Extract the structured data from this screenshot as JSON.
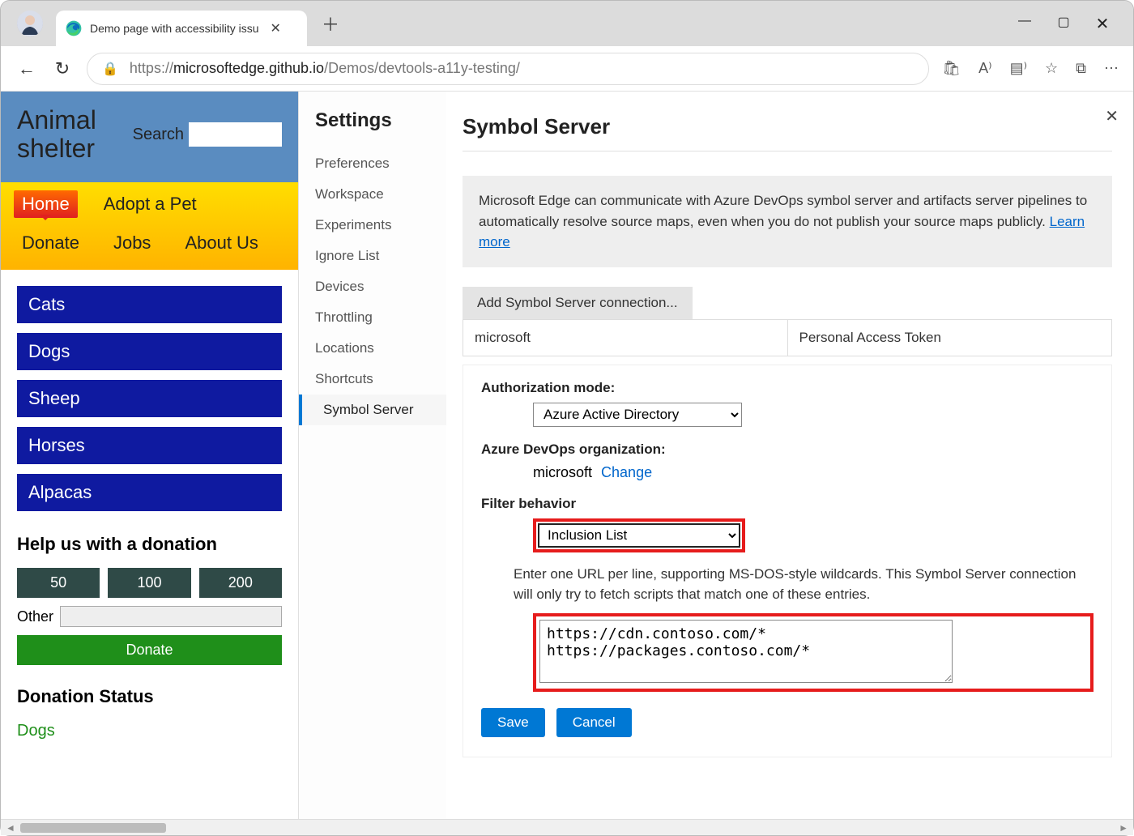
{
  "window": {
    "tab_title": "Demo page with accessibility issu",
    "url_proto": "https://",
    "url_host": "microsoftedge.github.io",
    "url_path": "/Demos/devtools-a11y-testing/"
  },
  "page": {
    "site_title": "Animal shelter",
    "search_label": "Search",
    "nav": {
      "home": "Home",
      "adopt": "Adopt a Pet",
      "donate": "Donate",
      "jobs": "Jobs",
      "about": "About Us"
    },
    "sidenav": [
      "Cats",
      "Dogs",
      "Sheep",
      "Horses",
      "Alpacas"
    ],
    "donation": {
      "heading": "Help us with a donation",
      "presets": [
        "50",
        "100",
        "200"
      ],
      "other_label": "Other",
      "button": "Donate"
    },
    "status": {
      "heading": "Donation Status",
      "rows": [
        "Dogs"
      ]
    }
  },
  "settings": {
    "title": "Settings",
    "items": [
      "Preferences",
      "Workspace",
      "Experiments",
      "Ignore List",
      "Devices",
      "Throttling",
      "Locations",
      "Shortcuts",
      "Symbol Server"
    ],
    "active": "Symbol Server"
  },
  "panel": {
    "title": "Symbol Server",
    "info": "Microsoft Edge can communicate with Azure DevOps symbol server and artifacts server pipelines to automatically resolve source maps, even when you do not publish your source maps publicly. ",
    "learn_more": "Learn more",
    "add_button": "Add Symbol Server connection...",
    "col_org": "microsoft",
    "col_auth": "Personal Access Token",
    "auth_label": "Authorization mode:",
    "auth_value": "Azure Active Directory",
    "org_label": "Azure DevOps organization:",
    "org_value": "microsoft",
    "org_change": "Change",
    "filter_label": "Filter behavior",
    "filter_value": "Inclusion List",
    "hint": "Enter one URL per line, supporting MS-DOS-style wildcards. This Symbol Server connection will only try to fetch scripts that match one of these entries.",
    "urls": "https://cdn.contoso.com/*\nhttps://packages.contoso.com/*",
    "save": "Save",
    "cancel": "Cancel"
  }
}
